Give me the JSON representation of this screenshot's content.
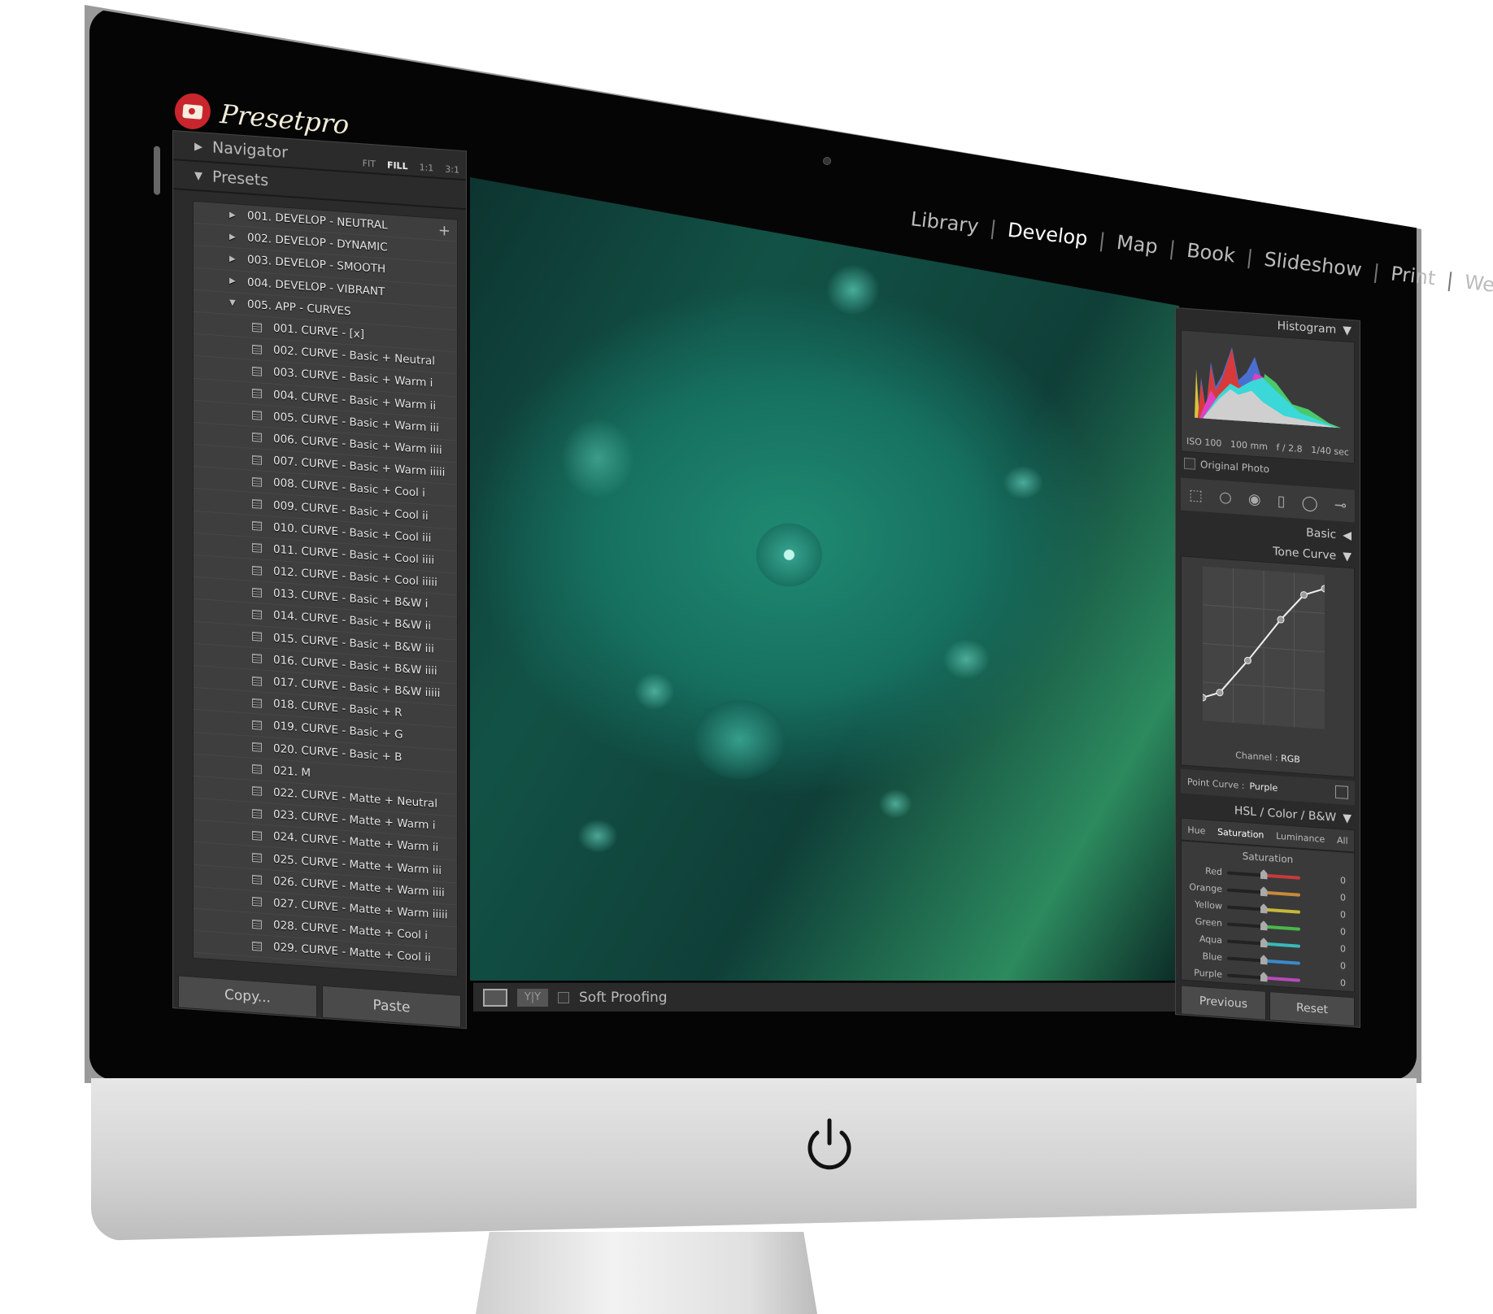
{
  "brand": {
    "name": "Presetpro",
    "color": "#c8262c"
  },
  "modules": [
    "Library",
    "Develop",
    "Map",
    "Book",
    "Slideshow",
    "Print",
    "Web"
  ],
  "active_module": "Develop",
  "left_panel": {
    "navigator": "Navigator",
    "zoom_options": [
      "FIT",
      "FILL",
      "1:1",
      "3:1"
    ],
    "zoom_selected": "FILL",
    "presets": "Presets",
    "groups": [
      "001. DEVELOP - NEUTRAL",
      "002. DEVELOP - DYNAMIC",
      "003. DEVELOP - SMOOTH",
      "004. DEVELOP - VIBRANT",
      "005. APP - CURVES"
    ],
    "items": [
      "001. CURVE - [x]",
      "002. CURVE - Basic + Neutral",
      "003. CURVE - Basic + Warm i",
      "004. CURVE - Basic + Warm ii",
      "005. CURVE - Basic + Warm iii",
      "006. CURVE - Basic + Warm iiii",
      "007. CURVE - Basic + Warm iiiii",
      "008. CURVE - Basic + Cool i",
      "009. CURVE - Basic + Cool ii",
      "010. CURVE - Basic + Cool iii",
      "011. CURVE - Basic + Cool iiii",
      "012. CURVE - Basic + Cool iiiii",
      "013. CURVE - Basic + B&W i",
      "014. CURVE - Basic + B&W ii",
      "015. CURVE - Basic + B&W iii",
      "016. CURVE - Basic + B&W iiii",
      "017. CURVE - Basic + B&W iiiii",
      "018. CURVE - Basic + R",
      "019. CURVE - Basic + G",
      "020. CURVE - Basic + B",
      "021. M",
      "022. CURVE - Matte + Neutral",
      "023. CURVE - Matte + Warm i",
      "024. CURVE - Matte + Warm ii",
      "025. CURVE - Matte + Warm iii",
      "026. CURVE - Matte + Warm iiii",
      "027. CURVE - Matte + Warm iiiii",
      "028. CURVE - Matte + Cool i",
      "029. CURVE - Matte + Cool ii"
    ],
    "copy": "Copy...",
    "paste": "Paste"
  },
  "toolbar": {
    "yy": "Y|Y",
    "soft_proofing": "Soft Proofing"
  },
  "right_panel": {
    "histogram": "Histogram",
    "exif": {
      "iso": "ISO 100",
      "focal": "100 mm",
      "aperture": "f / 2.8",
      "shutter": "1/40 sec"
    },
    "original_photo": "Original Photo",
    "basic": "Basic",
    "tone_curve": "Tone Curve",
    "curve_points": [
      [
        0,
        15
      ],
      [
        14,
        19
      ],
      [
        37,
        41
      ],
      [
        64,
        69
      ],
      [
        83,
        86
      ],
      [
        100,
        91
      ]
    ],
    "channel_label": "Channel :",
    "channel": "RGB",
    "point_curve_label": "Point Curve :",
    "point_curve": "Purple",
    "hsl_header": "HSL / Color / B&W",
    "hsl_tabs": [
      "Hue",
      "Saturation",
      "Luminance",
      "All"
    ],
    "hsl_active": "Saturation",
    "saturation_title": "Saturation",
    "sliders": [
      {
        "label": "Red",
        "value": "0",
        "color": "#c83a3a"
      },
      {
        "label": "Orange",
        "value": "0",
        "color": "#c88a3a"
      },
      {
        "label": "Yellow",
        "value": "0",
        "color": "#c8b83a"
      },
      {
        "label": "Green",
        "value": "0",
        "color": "#4ab84a"
      },
      {
        "label": "Aqua",
        "value": "0",
        "color": "#3ab8b8"
      },
      {
        "label": "Blue",
        "value": "0",
        "color": "#3a8ac8"
      },
      {
        "label": "Purple",
        "value": "0",
        "color": "#b84ab8"
      }
    ],
    "previous": "Previous",
    "reset": "Reset"
  }
}
